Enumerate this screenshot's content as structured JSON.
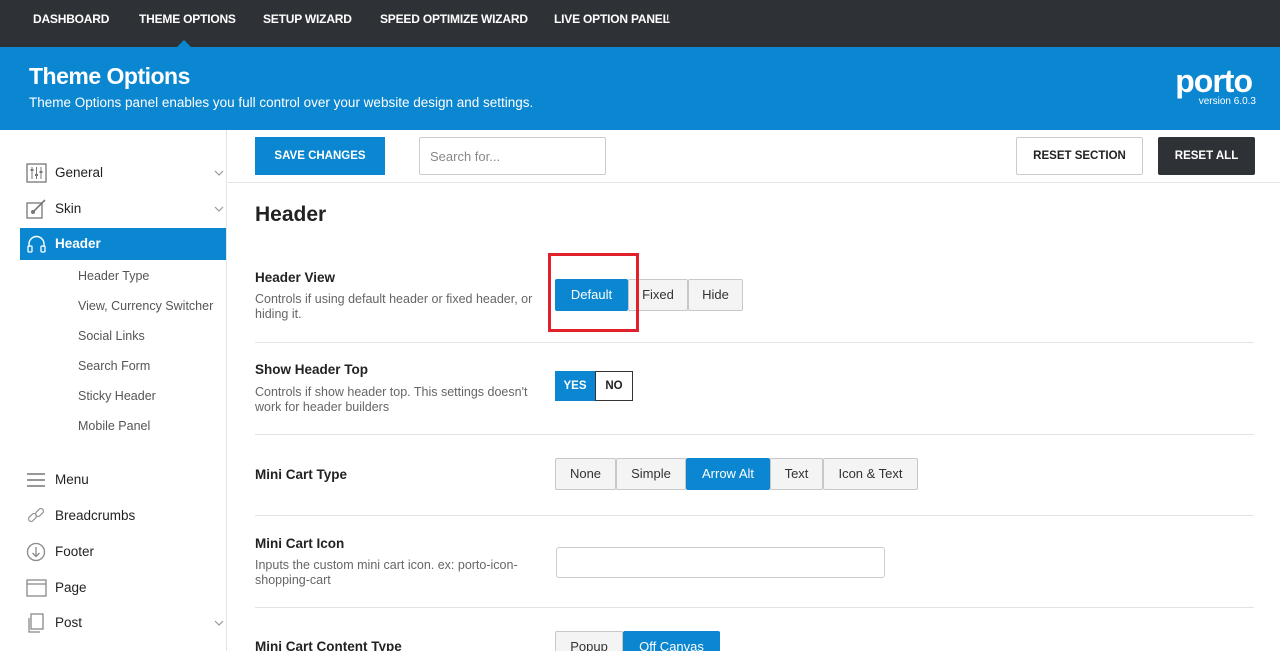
{
  "topnav": {
    "items": [
      "DASHBOARD",
      "THEME OPTIONS",
      "SETUP WIZARD",
      "SPEED OPTIMIZE WIZARD",
      "LIVE OPTION PANEL"
    ],
    "live_badge": "!"
  },
  "banner": {
    "title": "Theme Options",
    "subtitle": "Theme Options panel enables you full control over your website design and settings.",
    "logo": "porto",
    "version": "version 6.0.3"
  },
  "sidebar": {
    "items": [
      {
        "label": "General",
        "icon": "sliders-icon"
      },
      {
        "label": "Skin",
        "icon": "brush-icon"
      },
      {
        "label": "Header",
        "icon": "headphones-icon"
      },
      {
        "label": "Menu",
        "icon": "menu-icon"
      },
      {
        "label": "Breadcrumbs",
        "icon": "link-icon"
      },
      {
        "label": "Footer",
        "icon": "arrow-down-circle-icon"
      },
      {
        "label": "Page",
        "icon": "window-icon"
      },
      {
        "label": "Post",
        "icon": "copy-icon"
      }
    ],
    "subitems": [
      "Header Type",
      "View, Currency Switcher",
      "Social Links",
      "Search Form",
      "Sticky Header",
      "Mobile Panel"
    ]
  },
  "toolbar": {
    "save": "SAVE CHANGES",
    "search_placeholder": "Search for...",
    "reset_section": "RESET SECTION",
    "reset_all": "RESET ALL"
  },
  "section": {
    "title": "Header",
    "header_view": {
      "title": "Header View",
      "desc": "Controls if using default header or fixed header, or hiding it.",
      "options": [
        "Default",
        "Fixed",
        "Hide"
      ],
      "selected": "Default"
    },
    "show_header_top": {
      "title": "Show Header Top",
      "desc": "Controls if show header top. This settings doesn't work for header builders",
      "yes": "YES",
      "no": "NO",
      "selected": "YES"
    },
    "mini_cart_type": {
      "title": "Mini Cart Type",
      "options": [
        "None",
        "Simple",
        "Arrow Alt",
        "Text",
        "Icon & Text"
      ],
      "selected": "Arrow Alt"
    },
    "mini_cart_icon": {
      "title": "Mini Cart Icon",
      "desc": "Inputs the custom mini cart icon. ex: porto-icon-shopping-cart",
      "value": ""
    },
    "mini_cart_content_type": {
      "title": "Mini Cart Content Type",
      "options": [
        "Popup",
        "Off Canvas"
      ],
      "selected": "Off Canvas"
    }
  },
  "colors": {
    "accent": "#0b86d0",
    "topbar": "#2e3236",
    "highlight": "#e0202a"
  }
}
